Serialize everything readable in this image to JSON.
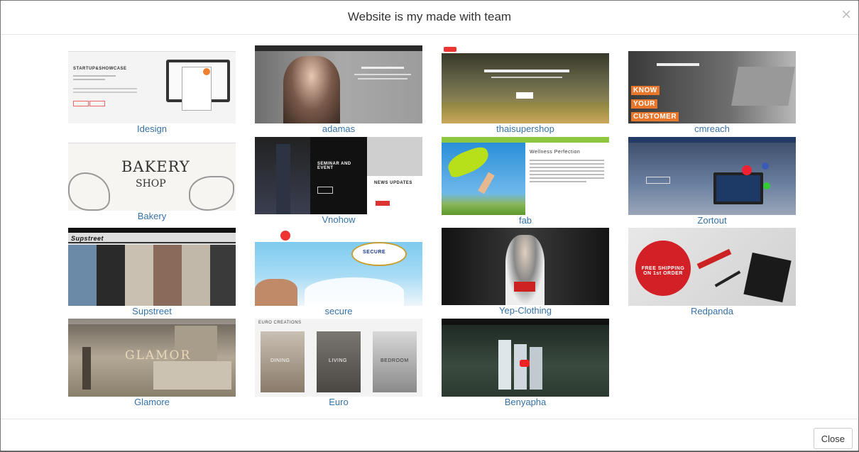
{
  "modal": {
    "title": "Website is my made with team",
    "close_symbol": "×",
    "footer": {
      "close_label": "Close"
    }
  },
  "portfolio": [
    {
      "label": "Idesign"
    },
    {
      "label": "adamas"
    },
    {
      "label": "thaisupershop"
    },
    {
      "label": "cmreach"
    },
    {
      "label": "Bakery"
    },
    {
      "label": "Vnohow"
    },
    {
      "label": "fab"
    },
    {
      "label": "Zortout"
    },
    {
      "label": "Supstreet"
    },
    {
      "label": "secure"
    },
    {
      "label": "Yep-Clothing"
    },
    {
      "label": "Redpanda"
    },
    {
      "label": "Glamore"
    },
    {
      "label": "Euro"
    },
    {
      "label": "Benyapha"
    }
  ],
  "thumb_text": {
    "idesign": "STARTUP&SHOWCASE",
    "cmreach_know": "KNOW",
    "cmreach_your": "YOUR",
    "cmreach_customer": "CUSTOMER",
    "bakery_title": "BAKERY",
    "bakery_sub": "SHOP",
    "vnohow_seminar": "SEMINAR AND EVENT",
    "vnohow_news": "NEWS UPDATES",
    "fab_heading": "Wellness Perfection",
    "supstreet_logo": "Supstreet",
    "secure_badge": "SECURE",
    "redpanda_offer": "FREE SHIPPING ON 1st ORDER",
    "euro_brand": "EURO CREATIONS",
    "euro_dining": "DINING",
    "euro_living": "LIVING",
    "euro_bedroom": "BEDROOM",
    "glamore_logo": "GLAMOR"
  }
}
